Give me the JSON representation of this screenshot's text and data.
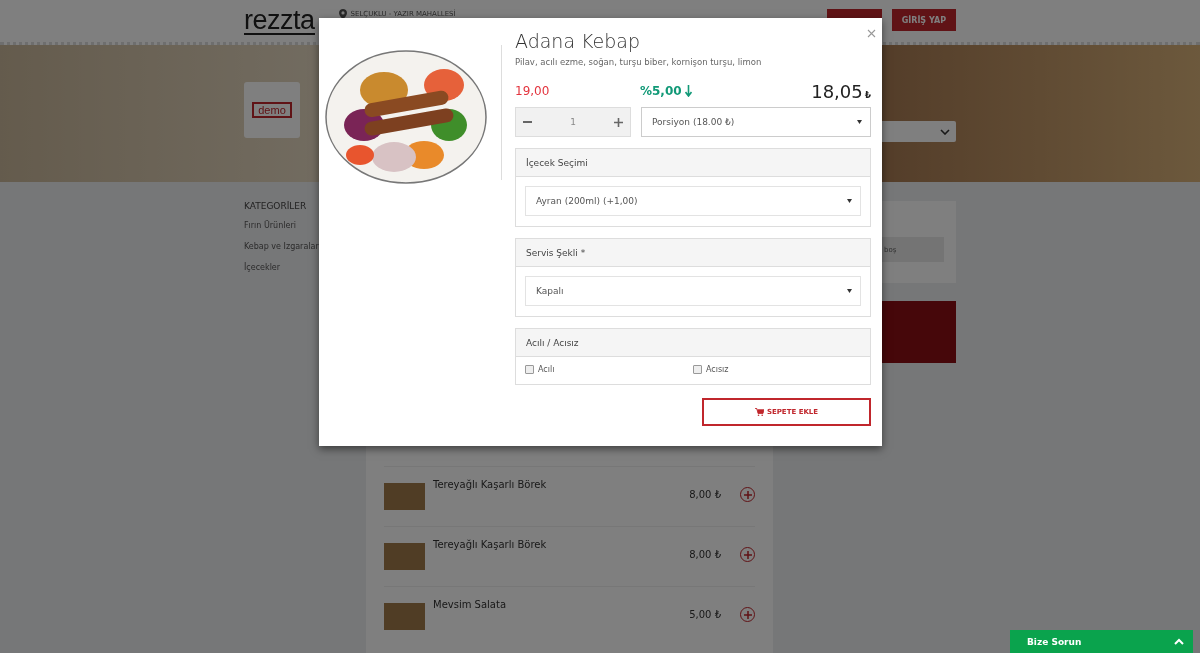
{
  "header": {
    "logo": "rezzta",
    "location": "SELÇUKLU - YAZIR MAHALLESİ",
    "login_button": "GİRİŞ YAP"
  },
  "hero": {
    "brand_logo": "demo"
  },
  "sidebar": {
    "title": "KATEGORİLER",
    "items": [
      {
        "label": "Fırın Ürünleri"
      },
      {
        "label": "Kebap ve Izgaralar"
      },
      {
        "label": "İçecekler"
      }
    ]
  },
  "products": [
    {
      "name": "Tereyağlı Kaşarlı Börek",
      "price": "8,00 ₺"
    },
    {
      "name": "Tereyağlı Kaşarlı Börek",
      "price": "8,00 ₺"
    },
    {
      "name": "Mevsim Salata",
      "price": "5,00 ₺"
    }
  ],
  "cart": {
    "text": "boş"
  },
  "modal": {
    "title": "Adana Kebap",
    "description": "Pilav, acılı ezme, soğan, turşu biber, kornişon turşu, limon",
    "old_price": "19,00",
    "discount": "%5,00",
    "price": "18,05",
    "currency": "₺",
    "quantity": "1",
    "portion": "Porsiyon (18.00 ₺)",
    "groups": [
      {
        "kind": "select",
        "title": "İçecek Seçimi",
        "value": "Ayran (200ml) (+1,00)"
      },
      {
        "kind": "select",
        "title": "Servis Şekli *",
        "value": "Kapalı"
      },
      {
        "kind": "checkboxes",
        "title": "Acılı / Acısız",
        "options": [
          {
            "label": "Acılı",
            "checked": false
          },
          {
            "label": "Acısız",
            "checked": false
          }
        ]
      }
    ],
    "add_button": "SEPETE EKLE"
  },
  "chat_bar": {
    "label": "Bize Sorun",
    "expanded": false
  }
}
